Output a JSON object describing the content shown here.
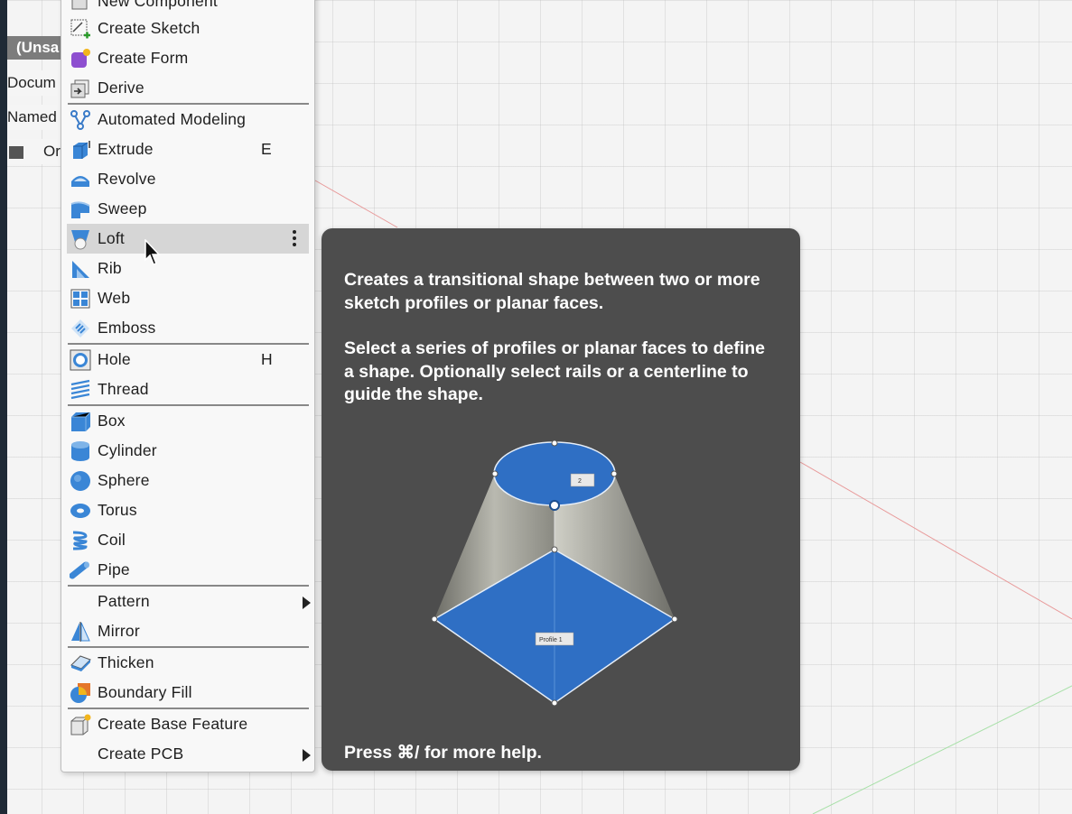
{
  "browser": {
    "title": "(Unsa",
    "rows": [
      "Docum",
      "Named",
      "Or"
    ]
  },
  "menu": {
    "items": [
      {
        "label": "New Component",
        "icon": "new-component-icon"
      },
      {
        "label": "Create Sketch",
        "icon": "create-sketch-icon"
      },
      {
        "label": "Create Form",
        "icon": "create-form-icon"
      },
      {
        "label": "Derive",
        "icon": "derive-icon"
      },
      {
        "label": "Automated Modeling",
        "icon": "automated-modeling-icon"
      },
      {
        "label": "Extrude",
        "icon": "extrude-icon",
        "shortcut": "E"
      },
      {
        "label": "Revolve",
        "icon": "revolve-icon"
      },
      {
        "label": "Sweep",
        "icon": "sweep-icon"
      },
      {
        "label": "Loft",
        "icon": "loft-icon"
      },
      {
        "label": "Rib",
        "icon": "rib-icon"
      },
      {
        "label": "Web",
        "icon": "web-icon"
      },
      {
        "label": "Emboss",
        "icon": "emboss-icon"
      },
      {
        "label": "Hole",
        "icon": "hole-icon",
        "shortcut": "H"
      },
      {
        "label": "Thread",
        "icon": "thread-icon"
      },
      {
        "label": "Box",
        "icon": "box-icon"
      },
      {
        "label": "Cylinder",
        "icon": "cylinder-icon"
      },
      {
        "label": "Sphere",
        "icon": "sphere-icon"
      },
      {
        "label": "Torus",
        "icon": "torus-icon"
      },
      {
        "label": "Coil",
        "icon": "coil-icon"
      },
      {
        "label": "Pipe",
        "icon": "pipe-icon"
      },
      {
        "label": "Pattern",
        "icon": "submenu-arrow-icon"
      },
      {
        "label": "Mirror",
        "icon": "mirror-icon"
      },
      {
        "label": "Thicken",
        "icon": "thicken-icon"
      },
      {
        "label": "Boundary Fill",
        "icon": "boundary-fill-icon"
      },
      {
        "label": "Create Base Feature",
        "icon": "create-base-feature-icon"
      },
      {
        "label": "Create PCB",
        "icon": "submenu-arrow-icon"
      }
    ]
  },
  "tooltip": {
    "para1": "Creates a transitional shape between two or more sketch profiles or planar faces.",
    "para2": "Select a series of profiles or planar faces to define a shape. Optionally select rails or a centerline to guide the shape.",
    "footer": "Press ⌘/ for more help.",
    "illustration": {
      "profile1_label": "Profile 1",
      "profile2_label": "2",
      "colors": {
        "face": "#2f6fc4",
        "side": "#9a9a92"
      }
    }
  },
  "colors": {
    "menu_highlight": "#d6d6d6",
    "tooltip_bg": "#4d4d4d",
    "left_strip": "#1f2a36"
  }
}
